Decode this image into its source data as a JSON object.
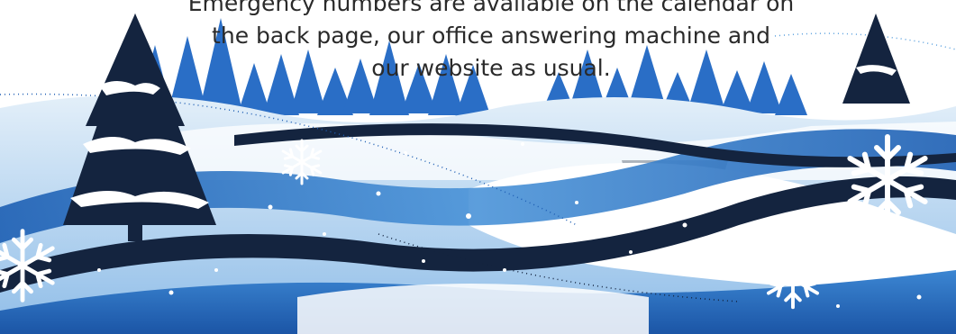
{
  "notice": {
    "lines": [
      "Emergency numbers are available on the calendar on",
      "the back page, our office answering machine and",
      "our website as usual."
    ]
  },
  "colors": {
    "navy": "#14243f",
    "royal_blue": "#1f5fb4",
    "sky_blue": "#5aa0de",
    "ice_blue": "#cfe4f6",
    "snow": "#ffffff"
  },
  "icons": [
    "pine-tree-icon",
    "snowflake-icon"
  ]
}
